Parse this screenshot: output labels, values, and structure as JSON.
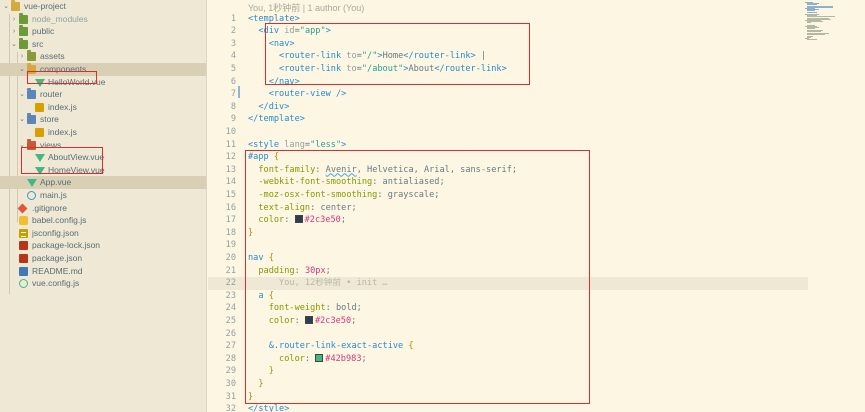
{
  "explorer": {
    "items": [
      {
        "label": "vue-project",
        "kind": "folder-open",
        "icon": "folder-icon",
        "depth": 0
      },
      {
        "label": "node_modules",
        "kind": "folder",
        "icon": "folder-green-icon",
        "depth": 1,
        "dimmed": true
      },
      {
        "label": "public",
        "kind": "folder",
        "icon": "folder-green-icon",
        "depth": 1
      },
      {
        "label": "src",
        "kind": "folder-open",
        "icon": "folder-green-icon",
        "depth": 1
      },
      {
        "label": "assets",
        "kind": "folder",
        "icon": "folder-olive-icon",
        "depth": 2
      },
      {
        "label": "components",
        "kind": "folder-open",
        "icon": "folder-icon",
        "depth": 2,
        "selected": true
      },
      {
        "label": "HelloWorld.vue",
        "kind": "file",
        "icon": "vue-icon",
        "depth": 3
      },
      {
        "label": "router",
        "kind": "folder-open",
        "icon": "folder-blue-icon",
        "depth": 2
      },
      {
        "label": "index.js",
        "kind": "file",
        "icon": "js-icon",
        "depth": 3
      },
      {
        "label": "store",
        "kind": "folder-open",
        "icon": "folder-blue-icon",
        "depth": 2
      },
      {
        "label": "index.js",
        "kind": "file",
        "icon": "js-icon",
        "depth": 3
      },
      {
        "label": "views",
        "kind": "folder-open",
        "icon": "folder-red-icon",
        "depth": 2
      },
      {
        "label": "AboutView.vue",
        "kind": "file",
        "icon": "vue-icon",
        "depth": 3
      },
      {
        "label": "HomeView.vue",
        "kind": "file",
        "icon": "vue-icon",
        "depth": 3
      },
      {
        "label": "App.vue",
        "kind": "file",
        "icon": "vue-icon",
        "depth": 2,
        "selected": true
      },
      {
        "label": "main.js",
        "kind": "file",
        "icon": "jsatom-icon",
        "depth": 2
      },
      {
        "label": ".gitignore",
        "kind": "file",
        "icon": "git-icon",
        "depth": 1
      },
      {
        "label": "babel.config.js",
        "kind": "file",
        "icon": "babel-icon",
        "depth": 1
      },
      {
        "label": "jsconfig.json",
        "kind": "file",
        "icon": "json-icon",
        "depth": 1
      },
      {
        "label": "package-lock.json",
        "kind": "file",
        "icon": "pkg-icon",
        "depth": 1
      },
      {
        "label": "package.json",
        "kind": "file",
        "icon": "pkg-icon",
        "depth": 1
      },
      {
        "label": "README.md",
        "kind": "file",
        "icon": "md-icon",
        "depth": 1
      },
      {
        "label": "vue.config.js",
        "kind": "file",
        "icon": "vuecfg-icon",
        "depth": 1
      }
    ]
  },
  "editor": {
    "blame_header": "You, 1秒钟前 | 1 author (You)",
    "inline_blame": "You, 12秒钟前 • init …",
    "lines": [
      {
        "n": "1",
        "tokens": [
          [
            "t-tag",
            "<template>"
          ]
        ]
      },
      {
        "n": "2",
        "tokens": [
          [
            "t-text",
            "  "
          ],
          [
            "t-tag",
            "<div "
          ],
          [
            "t-attr",
            "id"
          ],
          [
            "t-punct",
            "="
          ],
          [
            "t-str",
            "\"app\""
          ],
          [
            "t-tag",
            ">"
          ]
        ]
      },
      {
        "n": "3",
        "tokens": [
          [
            "t-text",
            "    "
          ],
          [
            "t-tag",
            "<nav>"
          ]
        ]
      },
      {
        "n": "4",
        "tokens": [
          [
            "t-text",
            "      "
          ],
          [
            "t-tag",
            "<router-link "
          ],
          [
            "t-attr",
            "to"
          ],
          [
            "t-punct",
            "="
          ],
          [
            "t-str",
            "\"/\""
          ],
          [
            "t-tag",
            ">"
          ],
          [
            "t-text",
            "Home"
          ],
          [
            "t-tag",
            "</router-link>"
          ],
          [
            "t-text",
            " |"
          ]
        ]
      },
      {
        "n": "5",
        "tokens": [
          [
            "t-text",
            "      "
          ],
          [
            "t-tag",
            "<router-link "
          ],
          [
            "t-attr",
            "to"
          ],
          [
            "t-punct",
            "="
          ],
          [
            "t-str",
            "\"/about\""
          ],
          [
            "t-tag",
            ">"
          ],
          [
            "t-text",
            "About"
          ],
          [
            "t-tag",
            "</router-link>"
          ]
        ]
      },
      {
        "n": "6",
        "tokens": [
          [
            "t-text",
            "    "
          ],
          [
            "t-tag",
            "</nav>"
          ]
        ]
      },
      {
        "n": "7",
        "tokens": [
          [
            "t-text",
            "    "
          ],
          [
            "t-tag",
            "<router-view />"
          ]
        ]
      },
      {
        "n": "8",
        "tokens": [
          [
            "t-text",
            "  "
          ],
          [
            "t-tag",
            "</div>"
          ]
        ]
      },
      {
        "n": "9",
        "tokens": [
          [
            "t-tag",
            "</template>"
          ]
        ]
      },
      {
        "n": "10",
        "tokens": []
      },
      {
        "n": "11",
        "tokens": [
          [
            "t-tag",
            "<style "
          ],
          [
            "t-attr",
            "lang"
          ],
          [
            "t-punct",
            "="
          ],
          [
            "t-str",
            "\"less\""
          ],
          [
            "t-tag",
            ">"
          ]
        ]
      },
      {
        "n": "12",
        "tokens": [
          [
            "t-sel",
            "#app"
          ],
          [
            "t-text",
            " "
          ],
          [
            "t-brace",
            "{"
          ]
        ]
      },
      {
        "n": "13",
        "tokens": [
          [
            "t-text",
            "  "
          ],
          [
            "t-prop",
            "font-family"
          ],
          [
            "t-punct",
            ": "
          ],
          [
            "t-err",
            "Avenir"
          ],
          [
            "t-val",
            ", Helvetica, Arial, sans-serif;"
          ]
        ]
      },
      {
        "n": "14",
        "tokens": [
          [
            "t-text",
            "  "
          ],
          [
            "t-prop",
            "-webkit-font-smoothing"
          ],
          [
            "t-punct",
            ": "
          ],
          [
            "t-val",
            "antialiased;"
          ]
        ]
      },
      {
        "n": "15",
        "tokens": [
          [
            "t-text",
            "  "
          ],
          [
            "t-prop",
            "-moz-osx-font-smoothing"
          ],
          [
            "t-punct",
            ": "
          ],
          [
            "t-val",
            "grayscale;"
          ]
        ]
      },
      {
        "n": "16",
        "tokens": [
          [
            "t-text",
            "  "
          ],
          [
            "t-prop",
            "text-align"
          ],
          [
            "t-punct",
            ": "
          ],
          [
            "t-val",
            "center;"
          ]
        ]
      },
      {
        "n": "17",
        "tokens": [
          [
            "t-text",
            "  "
          ],
          [
            "t-prop",
            "color"
          ],
          [
            "t-punct",
            ": "
          ],
          [
            "swatch",
            "#2c3e50"
          ],
          [
            "t-num",
            "#2c3e50"
          ],
          [
            "t-punct",
            ";"
          ]
        ]
      },
      {
        "n": "18",
        "tokens": [
          [
            "t-brace",
            "}"
          ]
        ]
      },
      {
        "n": "19",
        "tokens": []
      },
      {
        "n": "20",
        "tokens": [
          [
            "t-sel",
            "nav"
          ],
          [
            "t-text",
            " "
          ],
          [
            "t-brace",
            "{"
          ]
        ]
      },
      {
        "n": "21",
        "tokens": [
          [
            "t-text",
            "  "
          ],
          [
            "t-prop",
            "padding"
          ],
          [
            "t-punct",
            ": "
          ],
          [
            "t-num",
            "30px"
          ],
          [
            "t-punct",
            ";"
          ]
        ]
      },
      {
        "n": "22",
        "tokens": [
          [
            "t-text",
            "      "
          ],
          [
            "t-blame",
            "You, 12秒钟前 • init …"
          ]
        ],
        "current": true
      },
      {
        "n": "23",
        "tokens": [
          [
            "t-text",
            "  "
          ],
          [
            "t-sel",
            "a"
          ],
          [
            "t-text",
            " "
          ],
          [
            "t-brace",
            "{"
          ]
        ]
      },
      {
        "n": "24",
        "tokens": [
          [
            "t-text",
            "    "
          ],
          [
            "t-prop",
            "font-weight"
          ],
          [
            "t-punct",
            ": "
          ],
          [
            "t-val",
            "bold;"
          ]
        ]
      },
      {
        "n": "25",
        "tokens": [
          [
            "t-text",
            "    "
          ],
          [
            "t-prop",
            "color"
          ],
          [
            "t-punct",
            ": "
          ],
          [
            "swatch",
            "#2c3e50"
          ],
          [
            "t-num",
            "#2c3e50"
          ],
          [
            "t-punct",
            ";"
          ]
        ]
      },
      {
        "n": "26",
        "tokens": []
      },
      {
        "n": "27",
        "tokens": [
          [
            "t-text",
            "    "
          ],
          [
            "t-sel",
            "&.router-link-exact-active"
          ],
          [
            "t-text",
            " "
          ],
          [
            "t-brace",
            "{"
          ]
        ]
      },
      {
        "n": "28",
        "tokens": [
          [
            "t-text",
            "      "
          ],
          [
            "t-prop",
            "color"
          ],
          [
            "t-punct",
            ": "
          ],
          [
            "swatch",
            "#42b983"
          ],
          [
            "t-num",
            "#42b983"
          ],
          [
            "t-punct",
            ";"
          ]
        ]
      },
      {
        "n": "29",
        "tokens": [
          [
            "t-text",
            "    "
          ],
          [
            "t-brace",
            "}"
          ]
        ]
      },
      {
        "n": "30",
        "tokens": [
          [
            "t-text",
            "  "
          ],
          [
            "t-brace",
            "}"
          ]
        ]
      },
      {
        "n": "31",
        "tokens": [
          [
            "t-brace",
            "}"
          ]
        ]
      },
      {
        "n": "32",
        "tokens": [
          [
            "t-tag",
            "</style>"
          ]
        ]
      }
    ]
  },
  "colors": {
    "background": "#fdf6e3",
    "sidebar": "#eee8d5",
    "annotation": "#d92e2e",
    "vue_green": "#42b883"
  }
}
